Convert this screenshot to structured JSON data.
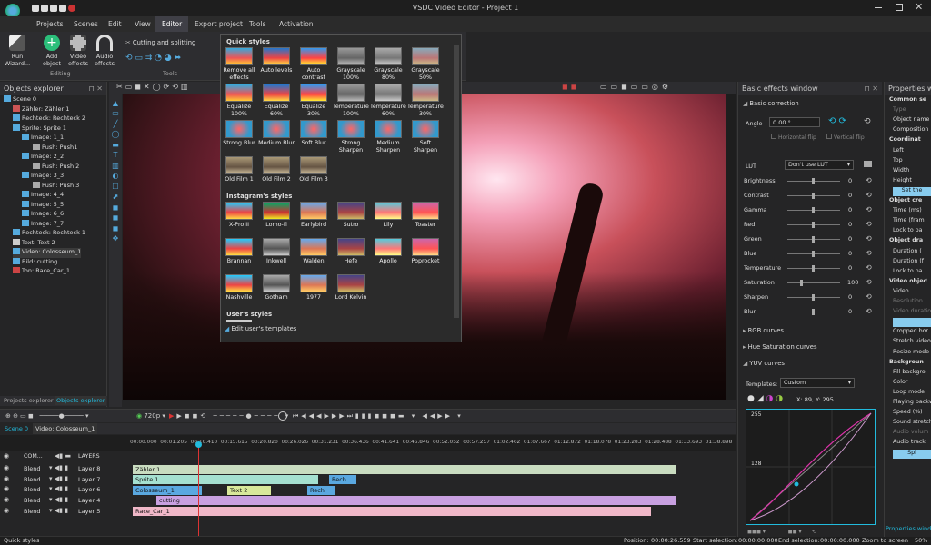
{
  "title": "VSDC Video Editor - Project 1",
  "menu": [
    "Projects",
    "Scenes",
    "Edit",
    "View",
    "Editor",
    "Export project",
    "Tools",
    "Activation"
  ],
  "ribbon": {
    "run_wizard": "Run Wizard...",
    "add_object": "Add object",
    "video_effects": "Video effects",
    "audio_effects": "Audio effects",
    "cutting": "Cutting and splitting",
    "editing_label": "Editing",
    "tools_label": "Tools"
  },
  "objects_explorer": {
    "title": "Objects explorer",
    "items": [
      {
        "label": "Scene 0"
      },
      {
        "label": "Zähler: Zähler 1"
      },
      {
        "label": "Rechteck: Rechteck 2"
      },
      {
        "label": "Sprite: Sprite 1"
      },
      {
        "label": "Image: 1_1"
      },
      {
        "label": "Push: Push1"
      },
      {
        "label": "Image: 2_2"
      },
      {
        "label": "Push: Push 2"
      },
      {
        "label": "Image: 3_3"
      },
      {
        "label": "Push: Push 3"
      },
      {
        "label": "Image: 4_4"
      },
      {
        "label": "Image: 5_5"
      },
      {
        "label": "Image: 6_6"
      },
      {
        "label": "Image: 7_7"
      },
      {
        "label": "Rechteck: Rechteck 1"
      },
      {
        "label": "Text: Text 2"
      },
      {
        "label": "Video: Colosseum_1"
      },
      {
        "label": "Bild: cutting"
      },
      {
        "label": "Ton: Race_Car_1"
      }
    ],
    "tabs": [
      "Projects explorer",
      "Objects explorer"
    ]
  },
  "quick_styles": {
    "title": "Quick styles",
    "items": [
      "Remove all effects",
      "Auto levels",
      "Auto contrast",
      "Grayscale 100%",
      "Grayscale 80%",
      "Grayscale 50%",
      "Equalize 100%",
      "Equalize 60%",
      "Equalize 30%",
      "Temperature 100%",
      "Temperature 60%",
      "Temperature 30%",
      "Strong Blur",
      "Medium Blur",
      "Soft Blur",
      "Strong Sharpen",
      "Medium Sharpen",
      "Soft Sharpen",
      "Old Film 1",
      "Old Film 2",
      "Old Film 3"
    ],
    "instagram_title": "Instagram's styles",
    "instagram": [
      "X-Pro II",
      "Lomo-fi",
      "Earlybird",
      "Sutro",
      "Lily",
      "Toaster",
      "Brannan",
      "Inkwell",
      "Walden",
      "Hefe",
      "Apollo",
      "Poprocket",
      "Nashville",
      "Gotham",
      "1977",
      "Lord Kelvin"
    ],
    "user_title": "User's styles",
    "edit_templates": "Edit user's templates"
  },
  "basic_effects": {
    "title": "Basic effects window",
    "basic_correction": "Basic correction",
    "angle_label": "Angle",
    "angle_value": "0.00 °",
    "h_flip": "Horizontal flip",
    "v_flip": "Vertical flip",
    "lut_label": "LUT",
    "lut_value": "Don't use LUT",
    "sliders": [
      {
        "name": "Brightness",
        "value": "0"
      },
      {
        "name": "Contrast",
        "value": "0"
      },
      {
        "name": "Gamma",
        "value": "0"
      },
      {
        "name": "Red",
        "value": "0"
      },
      {
        "name": "Green",
        "value": "0"
      },
      {
        "name": "Blue",
        "value": "0"
      },
      {
        "name": "Temperature",
        "value": "0"
      },
      {
        "name": "Saturation",
        "value": "100"
      },
      {
        "name": "Sharpen",
        "value": "0"
      },
      {
        "name": "Blur",
        "value": "0"
      }
    ],
    "rgb_curves": "RGB curves",
    "hue_curves": "Hue Saturation curves",
    "yuv_curves": "YUV curves",
    "templates_label": "Templates:",
    "templates_value": "Custom",
    "coords": "X: 89, Y: 295",
    "curve_labels": [
      "255",
      "128"
    ]
  },
  "properties": {
    "title": "Properties wi",
    "rows": [
      "Common se",
      "Type",
      "Object name",
      "Composition",
      "Coordinat",
      "Left",
      "Top",
      "Width",
      "Height",
      "Set the",
      "Object cre",
      "Time (ms)",
      "Time (fram",
      "Lock to pa",
      "Object dra",
      "Duration (",
      "Duration (f",
      "Lock to pa",
      "Video object",
      "Video",
      "Resolution",
      "Video duratio",
      "",
      "Cropped bor",
      "Stretch video",
      "Resize mode",
      "Backgroun",
      "Fill backgro",
      "Color",
      "Loop mode",
      "Playing backw",
      "Speed (%)",
      "Sound stretch",
      "Audio volum",
      "Audio track",
      "Spl"
    ],
    "footer": "Properties window"
  },
  "timeline": {
    "resolution": "720p",
    "tabs": [
      "Scene 0",
      "Video: Colosseum_1"
    ],
    "layers_label": "LAYERS",
    "com_label": "COM...",
    "times": [
      "00:00.000",
      "00:01.205",
      "00:10.410",
      "00:15.615",
      "00:20.820",
      "00:26.026",
      "00:31.231",
      "00:36.436",
      "00:41.641",
      "00:46.846",
      "00:52.052",
      "00:57.257",
      "01:02.462",
      "01:07.667",
      "01:12.872",
      "01:18.078",
      "01:23.283",
      "01:28.488",
      "01:33.693",
      "01:38.898"
    ],
    "layers": [
      {
        "blend": "Blend",
        "name": "Layer 8"
      },
      {
        "blend": "Blend",
        "name": "Layer 7"
      },
      {
        "blend": "Blend",
        "name": "Layer 6"
      },
      {
        "blend": "Blend",
        "name": "Layer 4"
      },
      {
        "blend": "Blend",
        "name": "Layer 5"
      }
    ],
    "clips": {
      "zahler": "Zähler 1",
      "sprite": "Sprite 1",
      "rech1": "Rech",
      "colosseum": "Colosseum_1",
      "text2": "Text 2",
      "rech2": "Rech",
      "cutting": "cutting",
      "race": "Race_Car_1"
    }
  },
  "status": {
    "left": "Quick styles",
    "position_label": "Position:",
    "position": "00:00:26.559",
    "start_label": "Start selection:",
    "start": "00:00:00.000",
    "end_label": "End selection:",
    "end": "00:00:00.000",
    "zoom_label": "Zoom to screen",
    "zoom": "50%"
  }
}
